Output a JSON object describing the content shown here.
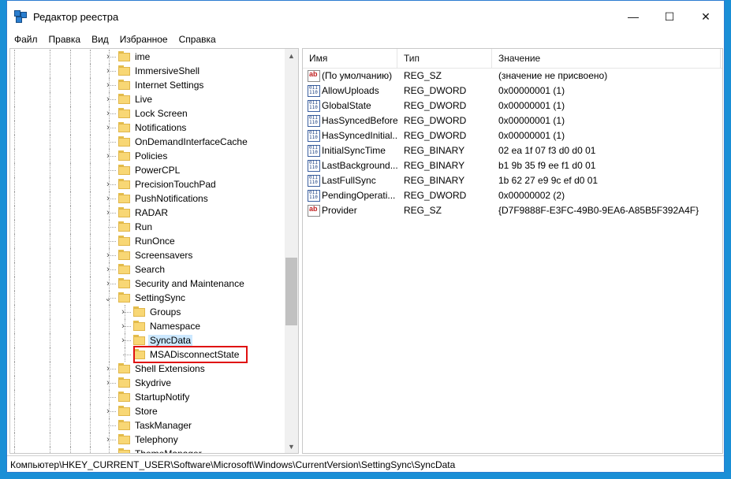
{
  "window": {
    "title": "Редактор реестра",
    "controls": {
      "minimize": "—",
      "maximize": "☐",
      "close": "✕"
    }
  },
  "menu": [
    "Файл",
    "Правка",
    "Вид",
    "Избранное",
    "Справка"
  ],
  "tree": [
    {
      "label": "ime",
      "level": 0,
      "expander": "›"
    },
    {
      "label": "ImmersiveShell",
      "level": 0,
      "expander": "›"
    },
    {
      "label": "Internet Settings",
      "level": 0,
      "expander": "›"
    },
    {
      "label": "Live",
      "level": 0,
      "expander": "›"
    },
    {
      "label": "Lock Screen",
      "level": 0,
      "expander": "›"
    },
    {
      "label": "Notifications",
      "level": 0,
      "expander": "›"
    },
    {
      "label": "OnDemandInterfaceCache",
      "level": 0,
      "expander": ""
    },
    {
      "label": "Policies",
      "level": 0,
      "expander": "›"
    },
    {
      "label": "PowerCPL",
      "level": 0,
      "expander": ""
    },
    {
      "label": "PrecisionTouchPad",
      "level": 0,
      "expander": "›"
    },
    {
      "label": "PushNotifications",
      "level": 0,
      "expander": "›"
    },
    {
      "label": "RADAR",
      "level": 0,
      "expander": "›"
    },
    {
      "label": "Run",
      "level": 0,
      "expander": ""
    },
    {
      "label": "RunOnce",
      "level": 0,
      "expander": ""
    },
    {
      "label": "Screensavers",
      "level": 0,
      "expander": "›"
    },
    {
      "label": "Search",
      "level": 0,
      "expander": "›"
    },
    {
      "label": "Security and Maintenance",
      "level": 0,
      "expander": "›"
    },
    {
      "label": "SettingSync",
      "level": 0,
      "expander": "⌄"
    },
    {
      "label": "Groups",
      "level": 1,
      "expander": "›"
    },
    {
      "label": "Namespace",
      "level": 1,
      "expander": "›"
    },
    {
      "label": "SyncData",
      "level": 1,
      "expander": "›",
      "selected": true
    },
    {
      "label": "MSADisconnectState",
      "level": 1,
      "expander": "",
      "highlighted": true
    },
    {
      "label": "Shell Extensions",
      "level": 0,
      "expander": "›"
    },
    {
      "label": "Skydrive",
      "level": 0,
      "expander": "›"
    },
    {
      "label": "StartupNotify",
      "level": 0,
      "expander": ""
    },
    {
      "label": "Store",
      "level": 0,
      "expander": "›"
    },
    {
      "label": "TaskManager",
      "level": 0,
      "expander": ""
    },
    {
      "label": "Telephony",
      "level": 0,
      "expander": "›"
    },
    {
      "label": "ThemeManager",
      "level": 0,
      "expander": ""
    }
  ],
  "scrollbar": {
    "position": 0.63,
    "up_arrow": "▲",
    "down_arrow": "▼"
  },
  "columns": {
    "name": "Имя",
    "type": "Тип",
    "value": "Значение"
  },
  "values": [
    {
      "name": "(По умолчанию)",
      "type": "REG_SZ",
      "data": "(значение не присвоено)",
      "icon": "string-value-icon"
    },
    {
      "name": "AllowUploads",
      "type": "REG_DWORD",
      "data": "0x00000001 (1)",
      "icon": "binary-value-icon"
    },
    {
      "name": "GlobalState",
      "type": "REG_DWORD",
      "data": "0x00000001 (1)",
      "icon": "binary-value-icon"
    },
    {
      "name": "HasSyncedBefore",
      "type": "REG_DWORD",
      "data": "0x00000001 (1)",
      "icon": "binary-value-icon"
    },
    {
      "name": "HasSyncedInitial...",
      "type": "REG_DWORD",
      "data": "0x00000001 (1)",
      "icon": "binary-value-icon"
    },
    {
      "name": "InitialSyncTime",
      "type": "REG_BINARY",
      "data": "02 ea 1f 07 f3 d0 d0 01",
      "icon": "binary-value-icon"
    },
    {
      "name": "LastBackground...",
      "type": "REG_BINARY",
      "data": "b1 9b 35 f9 ee f1 d0 01",
      "icon": "binary-value-icon"
    },
    {
      "name": "LastFullSync",
      "type": "REG_BINARY",
      "data": "1b 62 27 e9 9c ef d0 01",
      "icon": "binary-value-icon"
    },
    {
      "name": "PendingOperati...",
      "type": "REG_DWORD",
      "data": "0x00000002 (2)",
      "icon": "binary-value-icon"
    },
    {
      "name": "Provider",
      "type": "REG_SZ",
      "data": "{D7F9888F-E3FC-49B0-9EA6-A85B5F392A4F}",
      "icon": "string-value-icon"
    }
  ],
  "status": "Компьютер\\HKEY_CURRENT_USER\\Software\\Microsoft\\Windows\\CurrentVersion\\SettingSync\\SyncData"
}
